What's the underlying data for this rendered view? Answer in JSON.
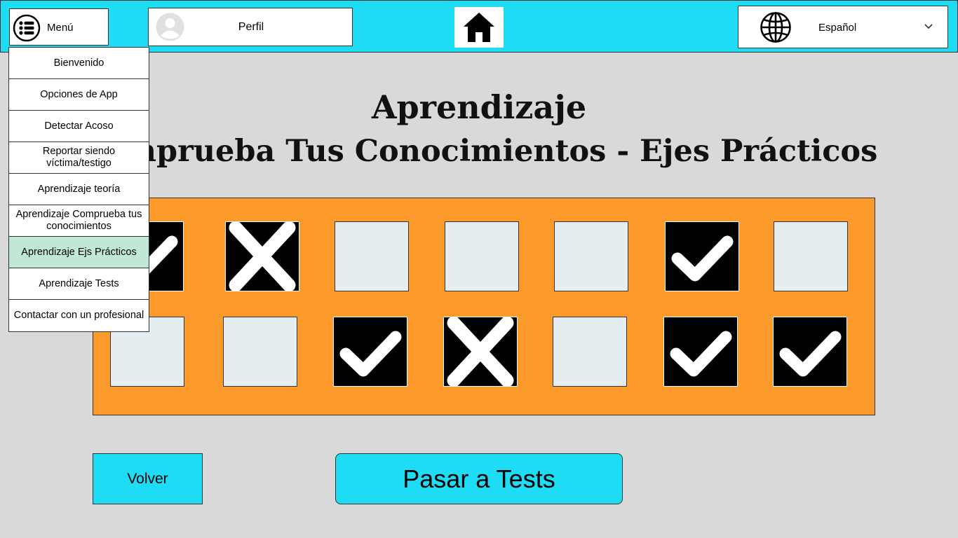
{
  "header": {
    "menu_label": "Menú",
    "profile_label": "Perfil",
    "language_label": "Español"
  },
  "menu": {
    "items": [
      {
        "label": "Bienvenido",
        "active": false
      },
      {
        "label": "Opciones de App",
        "active": false
      },
      {
        "label": "Detectar Acoso",
        "active": false
      },
      {
        "label": "Reportar siendo víctima/testigo",
        "active": false
      },
      {
        "label": "Aprendizaje teoría",
        "active": false
      },
      {
        "label": "Aprendizaje Comprueba tus conocimientos",
        "active": false
      },
      {
        "label": "Aprendizaje Ejs Prácticos",
        "active": true
      },
      {
        "label": "Aprendizaje Tests",
        "active": false
      },
      {
        "label": "Contactar con un profesional",
        "active": false
      }
    ]
  },
  "main": {
    "title_line1": "Aprendizaje",
    "title_line2": "Comprueba Tus Conocimientos - Ejes Prácticos"
  },
  "grid": {
    "rows": [
      [
        "check",
        "cross",
        "empty",
        "empty",
        "empty",
        "check",
        "empty"
      ],
      [
        "empty",
        "empty",
        "check",
        "cross",
        "empty",
        "check",
        "check"
      ]
    ]
  },
  "buttons": {
    "back_label": "Volver",
    "tests_label": "Pasar a Tests"
  },
  "colors": {
    "accent": "#1ddcf3",
    "board": "#fd9a2c",
    "active_menu": "#c0e8d6",
    "background": "#d9d9d9"
  }
}
